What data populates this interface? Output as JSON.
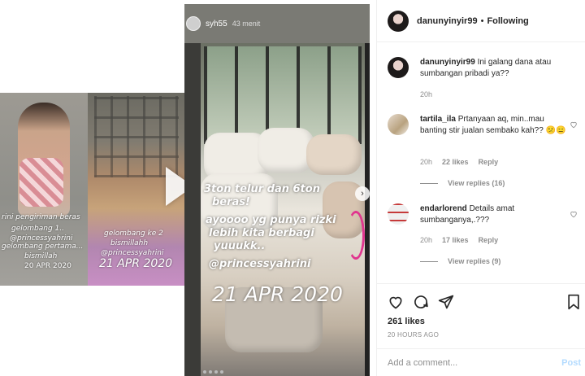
{
  "prev_story": {
    "line1": "rini pengiriman beras",
    "line2": "gelombang 1..",
    "line3": "@princessyahrini",
    "line4": "gelombang pertama...",
    "line5": "bismillah",
    "date_left": "20 APR 2020",
    "line6": "gelombang ke 2",
    "line7": "bismillahh",
    "line8": "@princessyahrini",
    "date_right": "21 APR 2020"
  },
  "story": {
    "user": "syh55",
    "time": "43 menit",
    "text_lines": [
      "3ton telur dan 6ton",
      "beras!",
      "ayoooo yg punya rizki",
      "lebih kita berbagi",
      "yuuukk..",
      "@princessyahrini"
    ],
    "date": "21 APR 2020"
  },
  "header": {
    "username": "danunyinyir99",
    "dot": "•",
    "follow_status": "Following"
  },
  "comments": [
    {
      "username": "danunyinyir99",
      "text": "Ini galang dana atau sumbangan pribadi ya??",
      "time": "20h"
    },
    {
      "username": "tartila_ila",
      "text": "Prtanyaan aq, min..mau banting stir jualan sembako kah?? 😕😑",
      "time": "20h",
      "likes": "22 likes",
      "reply": "Reply",
      "view_replies": "View replies (16)"
    },
    {
      "username": "endarlorend",
      "text": "Details amat sumbanganya,.???",
      "time": "20h",
      "likes": "17 likes",
      "reply": "Reply",
      "view_replies": "View replies (9)"
    }
  ],
  "actions": {
    "likes": "261 likes",
    "time_ago": "20 HOURS AGO"
  },
  "add_comment": {
    "placeholder": "Add a comment...",
    "post_label": "Post"
  },
  "colors": {
    "accent": "#e0358f",
    "post_disabled": "#b3dbff",
    "muted": "#8e8e8e"
  }
}
